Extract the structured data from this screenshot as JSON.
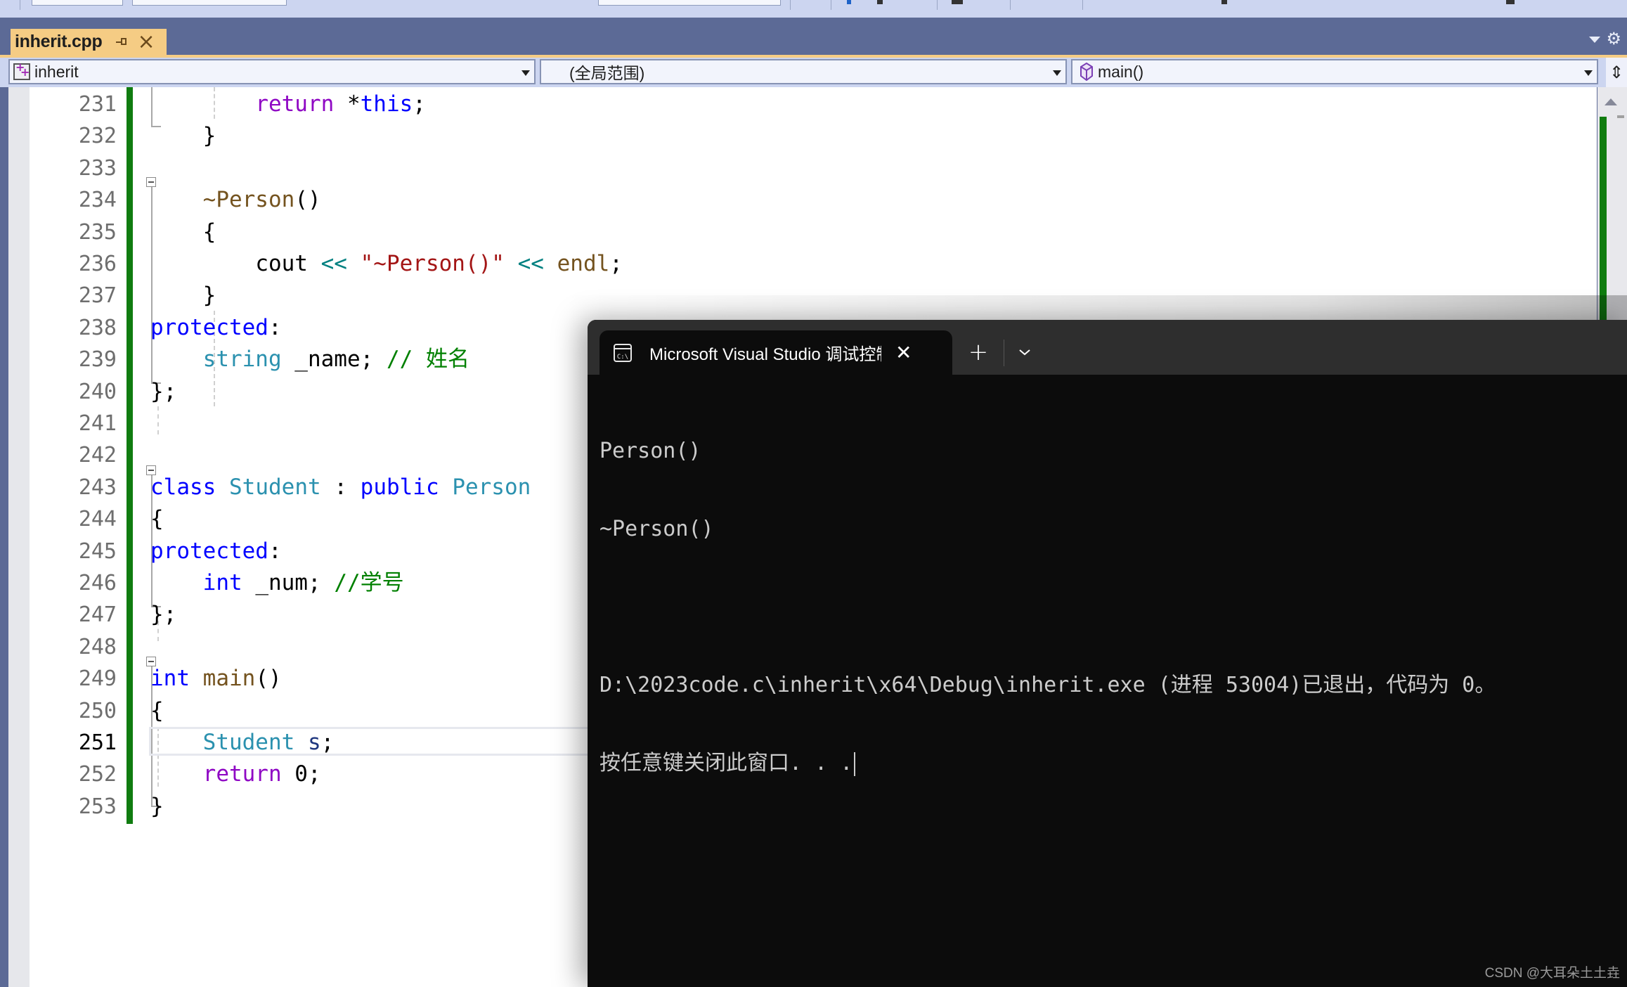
{
  "tab": {
    "filename": "inherit.cpp",
    "pin_icon": "pin-icon",
    "close_icon": "×"
  },
  "navbar": {
    "project": "inherit",
    "scope": "(全局范围)",
    "member": "main()"
  },
  "editor": {
    "lines": [
      {
        "num": "231",
        "tokens": [
          [
            "indent",
            "        "
          ],
          [
            "kwctl",
            "return"
          ],
          [
            "plain",
            " *"
          ],
          [
            "kw",
            "this"
          ],
          [
            "plain",
            ";"
          ]
        ]
      },
      {
        "num": "232",
        "tokens": [
          [
            "indent",
            "    "
          ],
          [
            "plain",
            "}"
          ]
        ]
      },
      {
        "num": "233",
        "tokens": []
      },
      {
        "num": "234",
        "tokens": [
          [
            "indent",
            "    "
          ],
          [
            "fn",
            "~Person"
          ],
          [
            "plain",
            "()"
          ]
        ]
      },
      {
        "num": "235",
        "tokens": [
          [
            "indent",
            "    "
          ],
          [
            "plain",
            "{"
          ]
        ]
      },
      {
        "num": "236",
        "tokens": [
          [
            "indent",
            "        "
          ],
          [
            "plain",
            "cout "
          ],
          [
            "op",
            "<<"
          ],
          [
            "plain",
            " "
          ],
          [
            "str",
            "\"~Person()\""
          ],
          [
            "plain",
            " "
          ],
          [
            "op",
            "<<"
          ],
          [
            "plain",
            " "
          ],
          [
            "fn",
            "endl"
          ],
          [
            "plain",
            ";"
          ]
        ]
      },
      {
        "num": "237",
        "tokens": [
          [
            "indent",
            "    "
          ],
          [
            "plain",
            "}"
          ]
        ]
      },
      {
        "num": "238",
        "tokens": [
          [
            "kw",
            "protected"
          ],
          [
            "plain",
            ":"
          ]
        ]
      },
      {
        "num": "239",
        "tokens": [
          [
            "indent",
            "    "
          ],
          [
            "type",
            "string"
          ],
          [
            "plain",
            " _name; "
          ],
          [
            "cmt",
            "// 姓名"
          ]
        ]
      },
      {
        "num": "240",
        "tokens": [
          [
            "plain",
            "};"
          ]
        ]
      },
      {
        "num": "241",
        "tokens": []
      },
      {
        "num": "242",
        "tokens": []
      },
      {
        "num": "243",
        "tokens": [
          [
            "kw",
            "class"
          ],
          [
            "plain",
            " "
          ],
          [
            "type",
            "Student"
          ],
          [
            "plain",
            " : "
          ],
          [
            "kw",
            "public"
          ],
          [
            "plain",
            " "
          ],
          [
            "type",
            "Person"
          ]
        ]
      },
      {
        "num": "244",
        "tokens": [
          [
            "plain",
            "{"
          ]
        ]
      },
      {
        "num": "245",
        "tokens": [
          [
            "kw",
            "protected"
          ],
          [
            "plain",
            ":"
          ]
        ]
      },
      {
        "num": "246",
        "tokens": [
          [
            "indent",
            "    "
          ],
          [
            "kw",
            "int"
          ],
          [
            "plain",
            " _num; "
          ],
          [
            "cmt",
            "//学号"
          ]
        ]
      },
      {
        "num": "247",
        "tokens": [
          [
            "plain",
            "};"
          ]
        ]
      },
      {
        "num": "248",
        "tokens": []
      },
      {
        "num": "249",
        "tokens": [
          [
            "kw",
            "int"
          ],
          [
            "plain",
            " "
          ],
          [
            "fn",
            "main"
          ],
          [
            "plain",
            "()"
          ]
        ]
      },
      {
        "num": "250",
        "tokens": [
          [
            "plain",
            "{"
          ]
        ]
      },
      {
        "num": "251",
        "tokens": [
          [
            "indent",
            "    "
          ],
          [
            "type",
            "Student"
          ],
          [
            "plain",
            " "
          ],
          [
            "var",
            "s"
          ],
          [
            "plain",
            ";"
          ]
        ]
      },
      {
        "num": "252",
        "tokens": [
          [
            "indent",
            "    "
          ],
          [
            "kwctl",
            "return"
          ],
          [
            "plain",
            " 0;"
          ]
        ]
      },
      {
        "num": "253",
        "tokens": [
          [
            "plain",
            "}"
          ]
        ]
      }
    ],
    "current_line": "251"
  },
  "console": {
    "tab_title": "Microsoft Visual Studio 调试控制台",
    "close_label": "✕",
    "new_tab_label": "+",
    "output_lines": [
      "Person()",
      "~Person()",
      "",
      "D:\\2023code.c\\inherit\\x64\\Debug\\inherit.exe (进程 53004)已退出，代码为 0。",
      "按任意键关闭此窗口. . ."
    ]
  },
  "watermark": "CSDN @大耳朵土土垚",
  "colors": {
    "tab_active": "#F5CC84",
    "tab_strip": "#5C6A96",
    "change_bar": "#107C10",
    "console_bg": "#0C0C0C"
  }
}
